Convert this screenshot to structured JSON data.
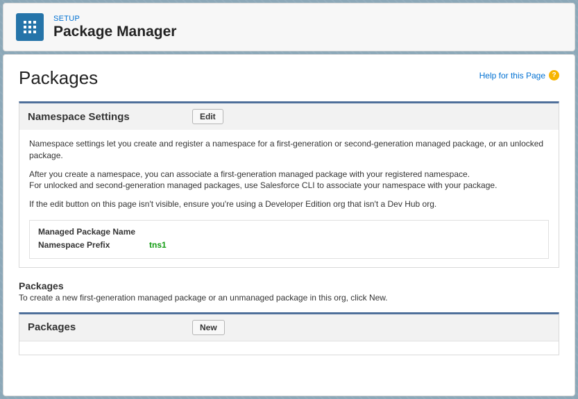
{
  "header": {
    "eyebrow": "SETUP",
    "title": "Package Manager"
  },
  "page": {
    "heading": "Packages",
    "helpLink": "Help for this Page",
    "helpIconGlyph": "?"
  },
  "namespacePanel": {
    "title": "Namespace Settings",
    "editButton": "Edit",
    "intro": "Namespace settings let you create and register a namespace for a first-generation or second-generation managed package, or an unlocked package.",
    "afterCreateLine": "After you create a namespace, you can associate a first-generation managed package with your registered namespace.",
    "unlockLine": "For unlocked and second-generation managed packages, use Salesforce CLI to associate your namespace with your package.",
    "editNote": "If the edit button on this page isn't visible, ensure you're using a Developer Edition org that isn't a Dev Hub org.",
    "fields": {
      "packageNameLabel": "Managed Package Name",
      "packageNameValue": "",
      "prefixLabel": "Namespace Prefix",
      "prefixValue": "tns1"
    }
  },
  "packagesSection": {
    "heading": "Packages",
    "description": "To create a new first-generation managed package or an unmanaged package in this org, click New."
  },
  "packagesPanel": {
    "title": "Packages",
    "newButton": "New"
  }
}
